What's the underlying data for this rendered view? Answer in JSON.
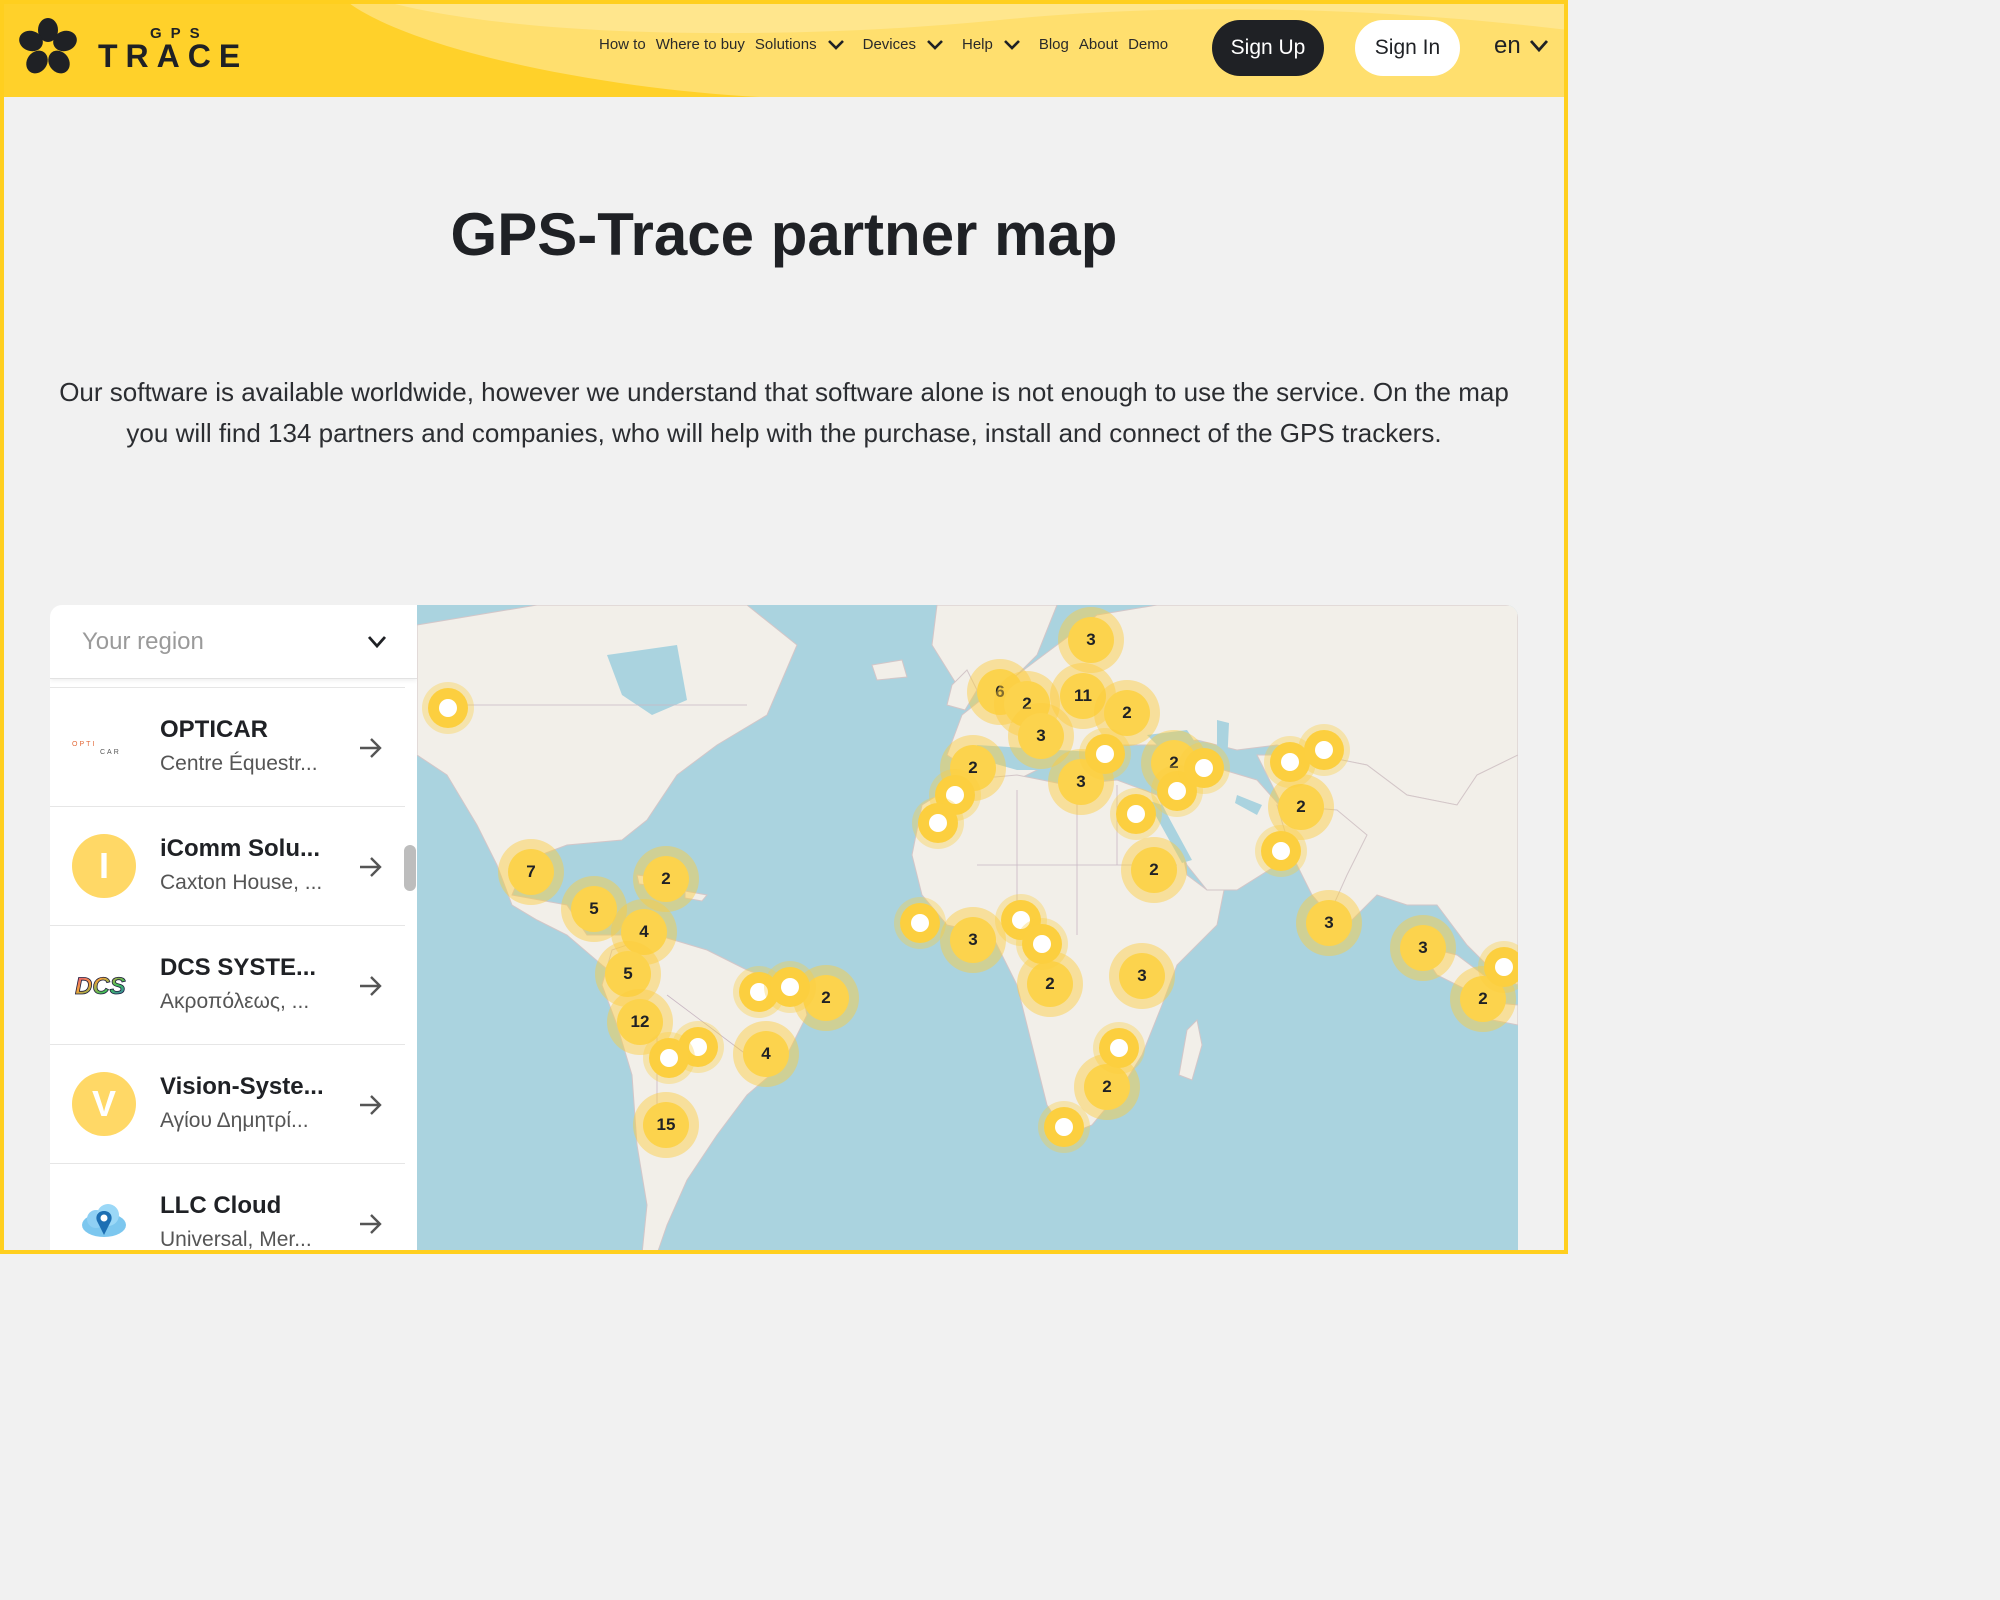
{
  "brand": {
    "logo_small": "GPS",
    "logo_big": "TRACE"
  },
  "nav": {
    "items": [
      {
        "label": "How to",
        "has_menu": false
      },
      {
        "label": "Where to buy",
        "has_menu": false
      },
      {
        "label": "Solutions",
        "has_menu": true
      },
      {
        "label": "Devices",
        "has_menu": true
      },
      {
        "label": "Help",
        "has_menu": true
      },
      {
        "label": "Blog",
        "has_menu": false
      },
      {
        "label": "About",
        "has_menu": false
      },
      {
        "label": "Demo",
        "has_menu": false
      }
    ],
    "sign_up": "Sign Up",
    "sign_in": "Sign In",
    "language": "en"
  },
  "hero": {
    "title": "GPS-Trace partner map",
    "intro": "Our software is available worldwide, however we understand that software alone is not enough to use the service. On the map you will find 134 partners and companies, who will help with the purchase, install and connect of the GPS trackers."
  },
  "sidebar": {
    "region_placeholder": "Your region",
    "partners": [
      {
        "name": "OPTICAR",
        "address": "Centre Équestr...",
        "thumb": "opticar-logo"
      },
      {
        "name": "iComm Solu...",
        "address": "Caxton House, ...",
        "thumb": "letter",
        "letter": "I"
      },
      {
        "name": "DCS SYSTE...",
        "address": "Ακροπόλεως, ...",
        "thumb": "dcs-logo"
      },
      {
        "name": "Vision-Syste...",
        "address": "Αγίου Δημητρί...",
        "thumb": "letter",
        "letter": "V"
      },
      {
        "name": "LLC Cloud",
        "address": "Universal, Mer...",
        "thumb": "cloud-pin-logo"
      }
    ]
  },
  "map": {
    "colors": {
      "water": "#aad3df",
      "land": "#f2efe9",
      "cluster": "#fcd34d"
    },
    "clusters": [
      "3",
      "6",
      "2",
      "11",
      "2",
      "3",
      "2",
      "3",
      "2",
      "2",
      "7",
      "2",
      "5",
      "4",
      "5",
      "12",
      "2",
      "4",
      "15",
      "3",
      "2",
      "3",
      "2",
      "3",
      "3",
      "2"
    ]
  }
}
